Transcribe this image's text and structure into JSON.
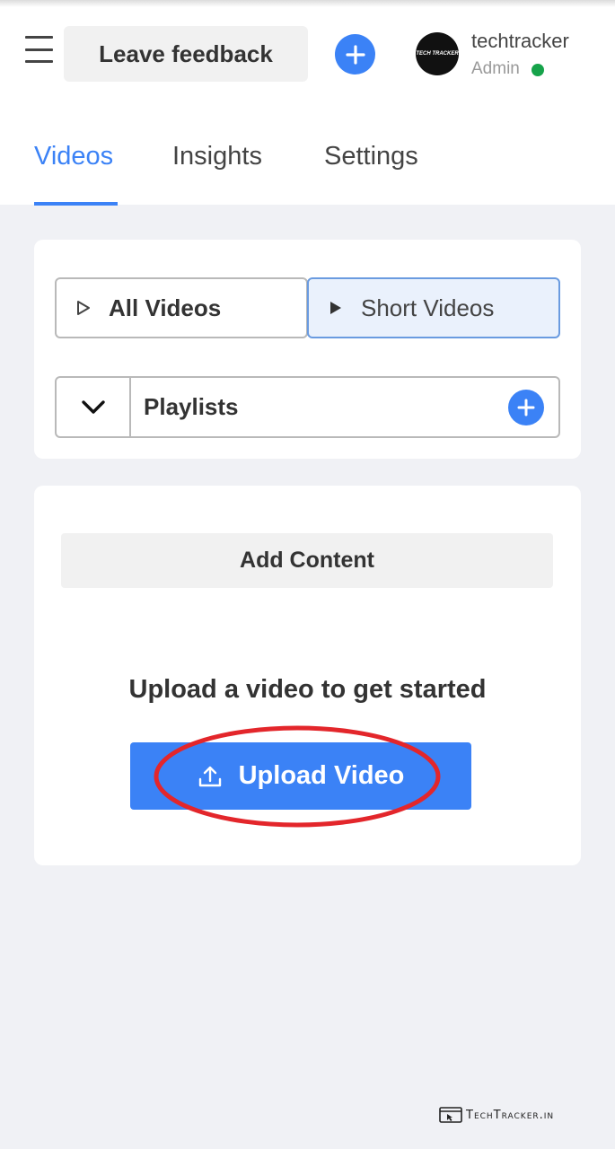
{
  "header": {
    "feedback_label": "Leave feedback",
    "user": {
      "name": "techtracker",
      "role": "Admin",
      "status_color": "#16a34a",
      "avatar_text": "TECH TRACKER"
    }
  },
  "tabs": [
    {
      "label": "Videos",
      "active": true
    },
    {
      "label": "Insights",
      "active": false
    },
    {
      "label": "Settings",
      "active": false
    }
  ],
  "filters": {
    "all_videos_label": "All Videos",
    "short_videos_label": "Short Videos",
    "selected": "Short Videos",
    "playlists_label": "Playlists"
  },
  "content": {
    "add_content_label": "Add Content",
    "upload_prompt": "Upload a video to get started",
    "upload_button_label": "Upload Video"
  },
  "watermark": "TechTracker.in",
  "colors": {
    "accent": "#3b82f6",
    "background": "#f0f1f5",
    "annotation_ring": "#e3262b"
  }
}
